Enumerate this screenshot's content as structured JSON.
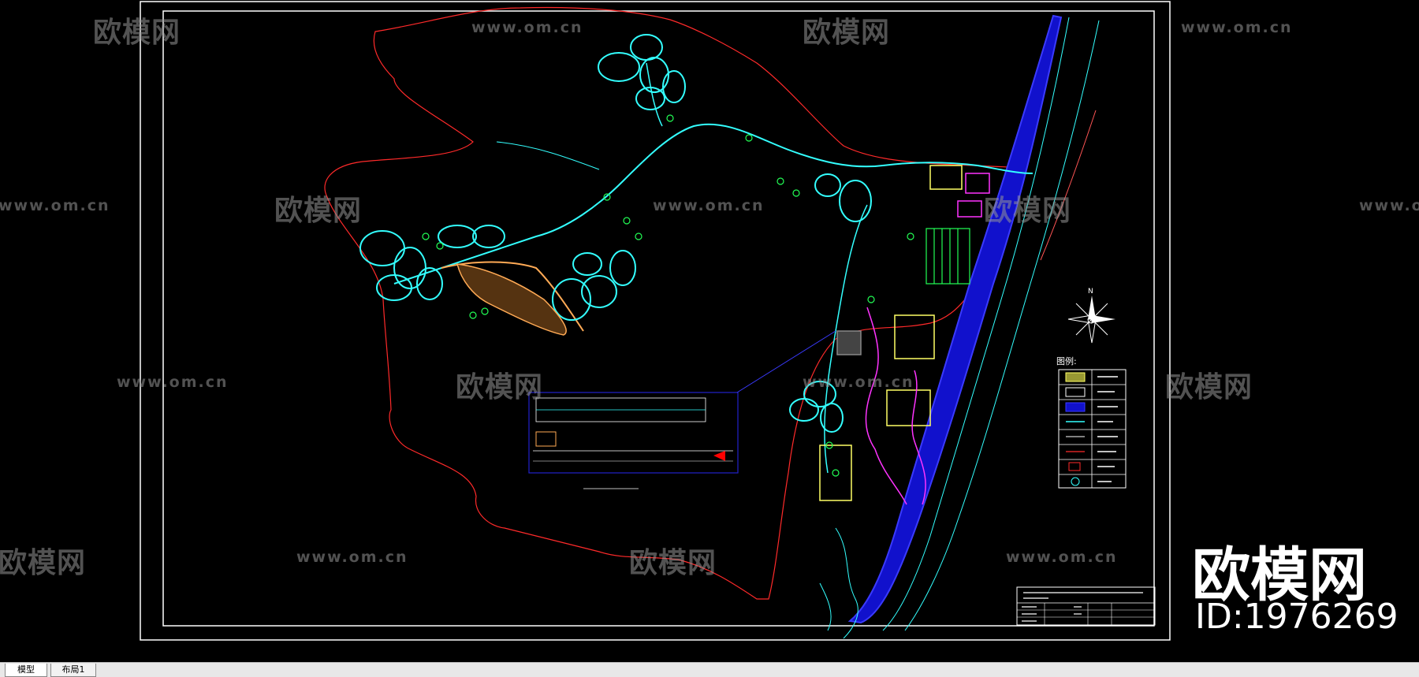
{
  "watermarks": {
    "brand_cn": "欧模网",
    "brand_url": "www.om.cn"
  },
  "brand_overlay": {
    "name": "欧模网",
    "id_label": "ID:1976269"
  },
  "drawing": {
    "legend_title": "图例:",
    "north_label": "N"
  },
  "tabs": [
    {
      "label": "模型",
      "active": true
    },
    {
      "label": "布局1",
      "active": false
    }
  ],
  "colors": {
    "background": "#000000",
    "boundary_red": "#ff2a2a",
    "path_cyan": "#33ffff",
    "road_blue": "#1a1aff",
    "building_magenta": "#ff33ff",
    "building_yellow": "#ffff66",
    "vegetation_green": "#22ff55"
  }
}
